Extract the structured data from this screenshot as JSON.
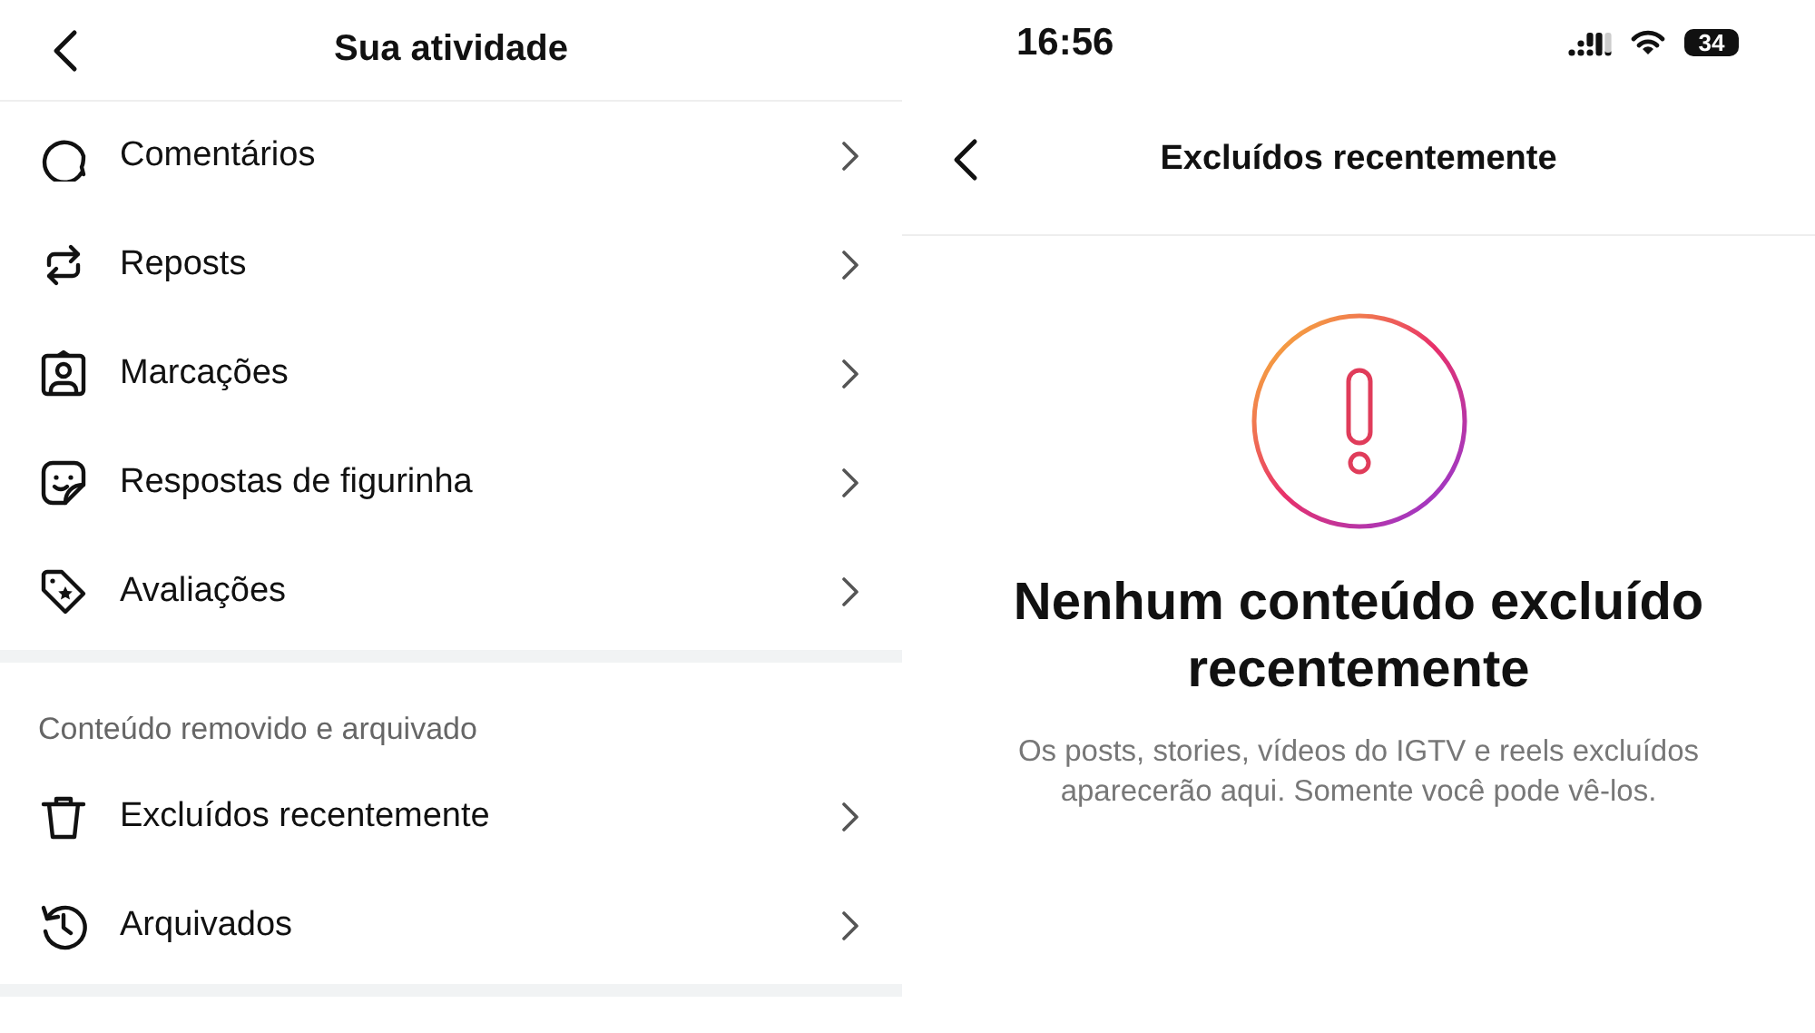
{
  "left": {
    "title": "Sua atividade",
    "items": [
      {
        "kind": "comment",
        "label": "Comentários"
      },
      {
        "kind": "repost",
        "label": "Reposts"
      },
      {
        "kind": "tag",
        "label": "Marcações"
      },
      {
        "kind": "sticker",
        "label": "Respostas de figurinha"
      },
      {
        "kind": "review",
        "label": "Avaliações"
      }
    ],
    "section": {
      "title": "Conteúdo removido e arquivado",
      "items": [
        {
          "kind": "trash",
          "label": "Excluídos recentemente"
        },
        {
          "kind": "archive",
          "label": "Arquivados"
        }
      ]
    }
  },
  "right": {
    "status_bar": {
      "time": "16:56",
      "battery": "34"
    },
    "title": "Excluídos recentemente",
    "empty": {
      "heading": "Nenhum conteúdo excluído recentemente",
      "text": "Os posts, stories, vídeos do IGTV e reels excluídos aparecerão aqui. Somente você pode vê-los."
    }
  }
}
